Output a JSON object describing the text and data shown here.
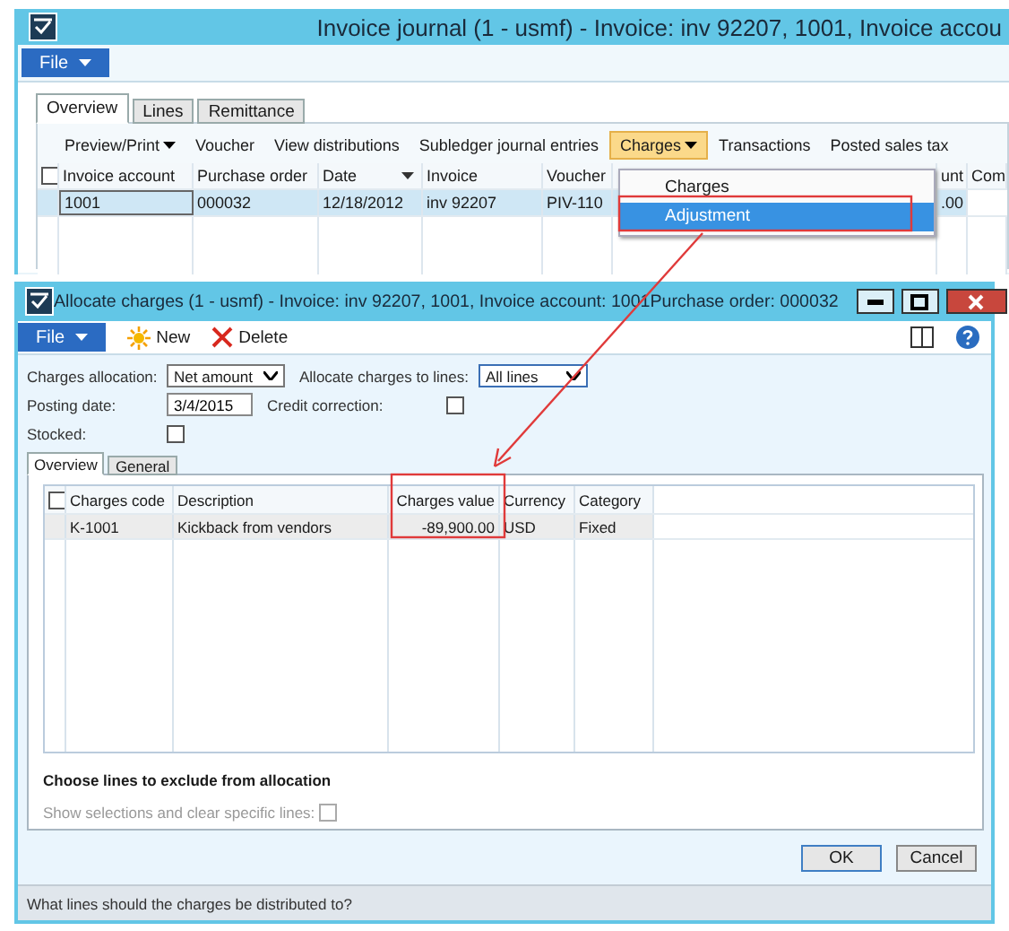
{
  "background_window": {
    "title": "Invoice journal (1 - usmf) - Invoice: inv 92207, 1001, Invoice accou",
    "file_menu": "File",
    "tabs": [
      {
        "label": "Overview",
        "selected": true
      },
      {
        "label": "Lines",
        "selected": false
      },
      {
        "label": "Remittance",
        "selected": false
      }
    ],
    "actions": [
      {
        "label": "Preview/Print",
        "dropdown": true,
        "selected": false
      },
      {
        "label": "Voucher",
        "dropdown": false,
        "selected": false
      },
      {
        "label": "View distributions",
        "dropdown": false,
        "selected": false
      },
      {
        "label": "Subledger journal entries",
        "dropdown": false,
        "selected": false
      },
      {
        "label": "Charges",
        "dropdown": true,
        "selected": true
      },
      {
        "label": "Transactions",
        "dropdown": false,
        "selected": false
      },
      {
        "label": "Posted sales tax",
        "dropdown": false,
        "selected": false
      }
    ],
    "grid": {
      "select_all": {
        "checked": false
      },
      "columns": [
        {
          "label": "Invoice account",
          "sorted": false
        },
        {
          "label": "Purchase order",
          "sorted": false
        },
        {
          "label": "Date",
          "sorted": true
        },
        {
          "label": "Invoice",
          "sorted": false
        },
        {
          "label": "Voucher",
          "sorted": false
        },
        {
          "label": "unt",
          "sorted": false
        },
        {
          "label": "Com",
          "sorted": false
        }
      ],
      "rows": [
        {
          "selected": true,
          "cells": [
            "1001",
            "000032",
            "12/18/2012",
            "inv 92207",
            "PIV-110",
            ".00"
          ]
        }
      ]
    },
    "menu": {
      "items": [
        {
          "label": "Charges",
          "selected": false
        },
        {
          "label": "Adjustment",
          "selected": true
        }
      ]
    }
  },
  "dialog": {
    "title": "Allocate charges (1 - usmf) - Invoice: inv 92207, 1001, Invoice account: 1001Purchase order: 000032",
    "file_menu": "File",
    "toolbar": [
      {
        "label": "New",
        "kind": "new"
      },
      {
        "label": "Delete",
        "kind": "delete"
      }
    ],
    "charges_allocation": {
      "label": "Charges allocation:",
      "value": "Net amount"
    },
    "allocate_to_lines": {
      "label": "Allocate charges to lines:",
      "value": "All lines"
    },
    "posting_date": {
      "label": "Posting date:",
      "value": "3/4/2015"
    },
    "credit_correction": {
      "label": "Credit correction:",
      "checked": false
    },
    "stocked": {
      "label": "Stocked:",
      "checked": false
    },
    "tabs": [
      {
        "label": "Overview",
        "selected": true
      },
      {
        "label": "General",
        "selected": false
      }
    ],
    "grid": {
      "select_all": {
        "checked": false
      },
      "columns": [
        "Charges code",
        "Description",
        "Charges value",
        "Currency",
        "Category"
      ],
      "rows": [
        {
          "selected": true,
          "cells": [
            "K-1001",
            "Kickback from vendors",
            "-89,900.00",
            "USD",
            "Fixed"
          ]
        }
      ]
    },
    "section_heading": "Choose lines to exclude from allocation",
    "show_selections": {
      "label": "Show selections and clear specific lines:",
      "checked": false,
      "disabled": true
    },
    "buttons": [
      "OK",
      "Cancel"
    ],
    "status_bar": "What lines should the charges be distributed to?"
  }
}
